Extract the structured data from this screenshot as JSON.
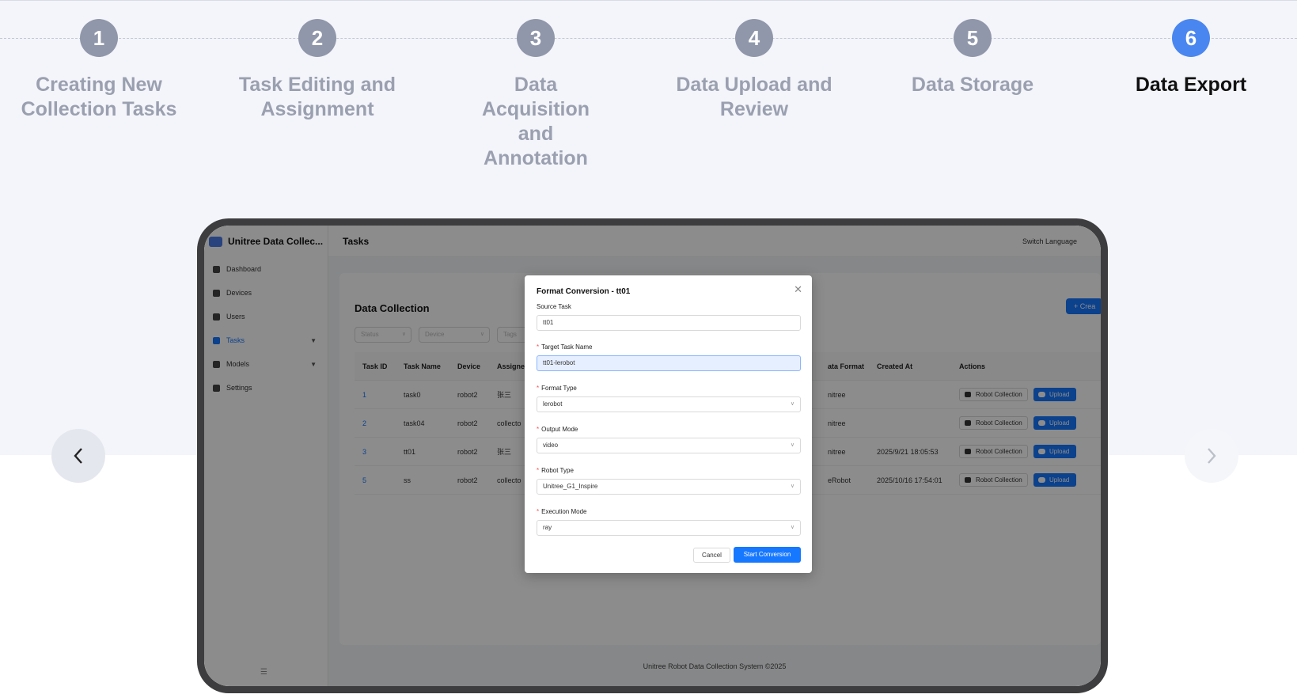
{
  "steps": [
    {
      "number": "1",
      "label": "Creating New Collection Tasks"
    },
    {
      "number": "2",
      "label": "Task Editing and Assignment"
    },
    {
      "number": "3",
      "label": "Data Acquisition and Annotation"
    },
    {
      "number": "4",
      "label": "Data Upload and Review"
    },
    {
      "number": "5",
      "label": "Data Storage"
    },
    {
      "number": "6",
      "label": "Data Export"
    }
  ],
  "carousel": {
    "prev_icon": "chevron-left-icon",
    "next_icon": "chevron-right-icon"
  },
  "app": {
    "brand": "Unitree Data Collec...",
    "page_title": "Tasks",
    "switch_language": "Switch Language",
    "sidebar": [
      {
        "label": "Dashboard",
        "icon": "dashboard-icon"
      },
      {
        "label": "Devices",
        "icon": "devices-icon"
      },
      {
        "label": "Users",
        "icon": "users-icon"
      },
      {
        "label": "Tasks",
        "icon": "tasks-icon"
      },
      {
        "label": "Models",
        "icon": "models-icon"
      },
      {
        "label": "Settings",
        "icon": "gear-icon"
      }
    ],
    "card_title": "Data Collection",
    "create_label": "+ Crea",
    "filters": {
      "status": "Status",
      "device": "Device",
      "tags": "Tags"
    },
    "table": {
      "headers": [
        "Task ID",
        "Task Name",
        "Device",
        "Assigne",
        "ata Format",
        "Created At",
        "Actions"
      ],
      "rows": [
        {
          "id": "1",
          "name": "task0",
          "device": "robot2",
          "assignee": "张三",
          "format": "nitree",
          "created": ""
        },
        {
          "id": "2",
          "name": "task04",
          "device": "robot2",
          "assignee": "collecto",
          "format": "nitree",
          "created": ""
        },
        {
          "id": "3",
          "name": "tt01",
          "device": "robot2",
          "assignee": "张三",
          "format": "nitree",
          "created": "2025/9/21 18:05:53"
        },
        {
          "id": "5",
          "name": "ss",
          "device": "robot2",
          "assignee": "collecto",
          "format": "eRobot",
          "created": "2025/10/16 17:54:01"
        }
      ],
      "action_robot": "Robot Collection",
      "action_upload": "Upload"
    },
    "footer": "Unitree Robot Data Collection System ©2025"
  },
  "modal": {
    "title": "Format Conversion - tt01",
    "source_task_label": "Source Task",
    "source_task_value": "tt01",
    "target_name_label": "Target Task Name",
    "target_name_value": "tt01-lerobot",
    "format_type_label": "Format Type",
    "format_type_value": "lerobot",
    "output_mode_label": "Output Mode",
    "output_mode_value": "video",
    "robot_type_label": "Robot Type",
    "robot_type_value": "Unitree_G1_Inspire",
    "execution_mode_label": "Execution Mode",
    "execution_mode_value": "ray",
    "cancel": "Cancel",
    "start": "Start Conversion"
  }
}
